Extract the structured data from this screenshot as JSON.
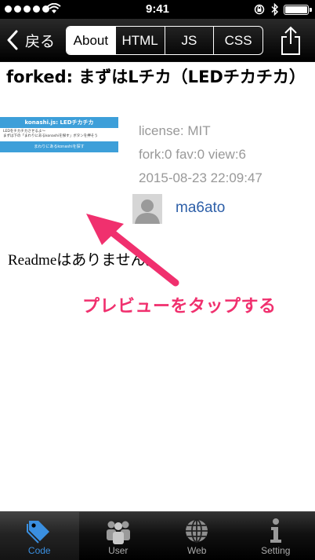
{
  "status_bar": {
    "time": "9:41"
  },
  "nav": {
    "back_label": "戻る",
    "tabs": [
      {
        "label": "About",
        "active": true
      },
      {
        "label": "HTML",
        "active": false
      },
      {
        "label": "JS",
        "active": false
      },
      {
        "label": "CSS",
        "active": false
      }
    ],
    "share_icon": "share-icon"
  },
  "content": {
    "title": "forked: まずはLチカ（LEDチカチカ）",
    "preview": {
      "header": "konashi.js: LEDチカチカ",
      "line1": "LEDをチカチカさせるよ〜",
      "line2": "まずは下の「まわりにあるkonashiを探す」ボタンを押そう",
      "button": "まわりにあるkonashiを探す"
    },
    "license": "license: MIT",
    "stats": "fork:0 fav:0 view:6",
    "date": "2015-08-23 22:09:47",
    "author": "ma6ato",
    "readme": "Readmeはありません。",
    "annotation": "プレビューをタップする"
  },
  "tabbar": {
    "items": [
      {
        "label": "Code",
        "icon": "tag-icon",
        "active": true
      },
      {
        "label": "User",
        "icon": "users-icon",
        "active": false
      },
      {
        "label": "Web",
        "icon": "globe-icon",
        "active": false
      },
      {
        "label": "Setting",
        "icon": "info-icon",
        "active": false
      }
    ]
  },
  "colors": {
    "accent": "#3a8fe0",
    "annotation": "#f0306e",
    "link": "#2d5fa8",
    "preview_blue": "#3d9fd9"
  }
}
